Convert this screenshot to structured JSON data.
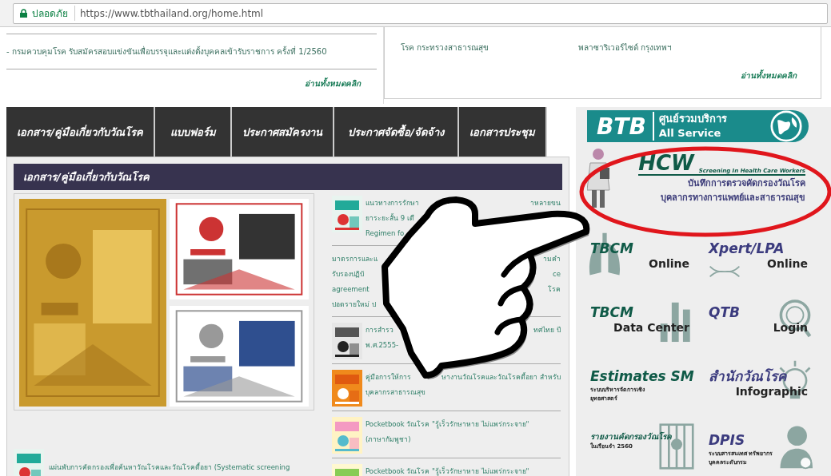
{
  "browser": {
    "security_label": "ปลอดภัย",
    "url": "https://www.tbthailand.org/home.html"
  },
  "news": {
    "left": {
      "items": [
        "- กรมควบคุมโรค รับสมัครสอบแข่งขันเพื่อบรรจุและแต่งตั้งบุคคลเข้ารับราชการ ครั้งที่ 1/2560"
      ],
      "more_link": "อ่านทั้งหมดคลิก"
    },
    "right": {
      "columns": [
        "โรค กระทรวงสาธารณสุข",
        "พลาซาริเวอร์ไซด์ กรุงเทพฯ"
      ],
      "more_link": "อ่านทั้งหมดคลิก"
    }
  },
  "nav_tabs": [
    {
      "label": "เอกสาร/คู่มือเกี่ยวกับวัณโรค"
    },
    {
      "label": "แบบฟอร์ม"
    },
    {
      "label": "ประกาศสมัครงาน"
    },
    {
      "label": "ประกาศจัดซื้อ/จัดจ้าง"
    },
    {
      "label": "เอกสารประชุม"
    }
  ],
  "section": {
    "title": "เอกสาร/คู่มือเกี่ยวกับวัณโรค",
    "documents": [
      {
        "thumbnail": true,
        "lines": [
          [
            "แนวทางการรักษา",
            "าหลายขน"
          ],
          [
            "ยาระยะสั้น 9 เดื"
          ],
          [
            "Regimen fo"
          ]
        ]
      },
      {
        "thumbnail": false,
        "lines": [
          [
            "มาตรการและแ",
            "ามคำ"
          ],
          [
            "รับรองปฏิบั",
            "ce"
          ],
          [
            "agreement",
            "โรค"
          ],
          [
            "ปอดรายใหม่ ป"
          ]
        ]
      },
      {
        "thumbnail": true,
        "lines": [
          [
            "การสำรว",
            "ทศไทย ปี"
          ],
          [
            "พ.ศ.2555-"
          ]
        ]
      },
      {
        "thumbnail": true,
        "lines": [
          [
            "คู่มือการให้การ",
            "ษางานวัณโรคและวัณโรคดื้อยา สำหรับ"
          ],
          [
            "บุคลากรสาธารณสุข"
          ]
        ]
      },
      {
        "thumbnail": true,
        "lines": [
          [
            "Pocketbook วัณโรค \"รู้เร็วรักษาหาย ไม่แพร่กระจาย\""
          ],
          [
            "(ภาษากัมพูชา)"
          ]
        ]
      },
      {
        "thumbnail": true,
        "lines": [
          [
            "Pocketbook วัณโรค \"รู้เร็วรักษาหาย ไม่แพร่กระจาย\""
          ]
        ]
      }
    ],
    "bottom_item": "แผ่นพับการคัดกรองเพื่อค้นหาวัณโรคและวัณโรคดื้อยา (Systematic screening"
  },
  "sidebar": {
    "banner": {
      "logo": "BTB",
      "title": "ศูนย์รวมบริการ",
      "subtitle": "All Service"
    },
    "hcw": {
      "logo": "HCW",
      "tagline": "Screening In Health Care Workers",
      "line1": "บันทึกการตรวจคัดกรองวัณโรค",
      "line2": "บุคลากรทางการแพทย์และสาธารณสุข"
    },
    "tiles": [
      {
        "kind": "lungs",
        "title": "TBCM",
        "subtitle": "Online",
        "color": "#0f5a47"
      },
      {
        "kind": "dna",
        "title": "Xpert/LPA",
        "subtitle": "Online",
        "color": "#3b3b7e"
      },
      {
        "kind": "bars",
        "title": "TBCM",
        "subtitle": "Data Center",
        "color": "#0f5a47"
      },
      {
        "kind": "magnifier",
        "title": "QTB",
        "subtitle": "Login",
        "color": "#3b3b7e"
      },
      {
        "kind": "plain",
        "title": "Estimates SM",
        "subtitle": "ระบบบริหารจัดการเชิงยุทธศาสตร์",
        "color": "#0f5a47"
      },
      {
        "kind": "bulb",
        "title": "สำนักวัณโรค",
        "subtitle": "Infographic",
        "color": "#3b3b7e"
      },
      {
        "kind": "prison",
        "title": "รายงานคัดกรองวัณโรค",
        "subtitle": "ในเรือนจำ 2560",
        "color": "#0f5a47"
      },
      {
        "kind": "person",
        "title": "DPIS",
        "subtitle": "ระบบสารสนเทศ ทรัพยากรบุคคลระดับกรม",
        "color": "#3b3b7e"
      }
    ]
  }
}
